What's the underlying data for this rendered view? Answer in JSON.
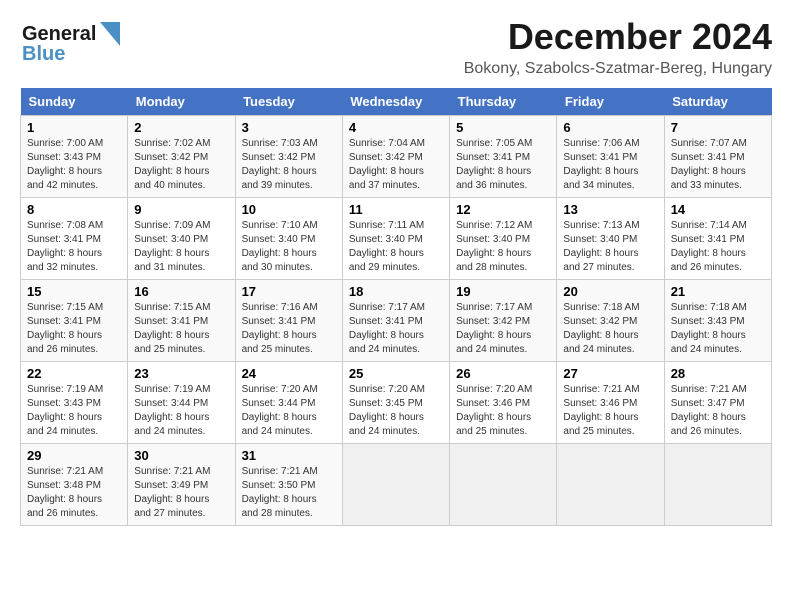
{
  "header": {
    "logo_line1": "General",
    "logo_line2": "Blue",
    "month": "December 2024",
    "location": "Bokony, Szabolcs-Szatmar-Bereg, Hungary"
  },
  "weekdays": [
    "Sunday",
    "Monday",
    "Tuesday",
    "Wednesday",
    "Thursday",
    "Friday",
    "Saturday"
  ],
  "weeks": [
    [
      {
        "day": "1",
        "sunrise": "Sunrise: 7:00 AM",
        "sunset": "Sunset: 3:43 PM",
        "daylight": "Daylight: 8 hours and 42 minutes."
      },
      {
        "day": "2",
        "sunrise": "Sunrise: 7:02 AM",
        "sunset": "Sunset: 3:42 PM",
        "daylight": "Daylight: 8 hours and 40 minutes."
      },
      {
        "day": "3",
        "sunrise": "Sunrise: 7:03 AM",
        "sunset": "Sunset: 3:42 PM",
        "daylight": "Daylight: 8 hours and 39 minutes."
      },
      {
        "day": "4",
        "sunrise": "Sunrise: 7:04 AM",
        "sunset": "Sunset: 3:42 PM",
        "daylight": "Daylight: 8 hours and 37 minutes."
      },
      {
        "day": "5",
        "sunrise": "Sunrise: 7:05 AM",
        "sunset": "Sunset: 3:41 PM",
        "daylight": "Daylight: 8 hours and 36 minutes."
      },
      {
        "day": "6",
        "sunrise": "Sunrise: 7:06 AM",
        "sunset": "Sunset: 3:41 PM",
        "daylight": "Daylight: 8 hours and 34 minutes."
      },
      {
        "day": "7",
        "sunrise": "Sunrise: 7:07 AM",
        "sunset": "Sunset: 3:41 PM",
        "daylight": "Daylight: 8 hours and 33 minutes."
      }
    ],
    [
      {
        "day": "8",
        "sunrise": "Sunrise: 7:08 AM",
        "sunset": "Sunset: 3:41 PM",
        "daylight": "Daylight: 8 hours and 32 minutes."
      },
      {
        "day": "9",
        "sunrise": "Sunrise: 7:09 AM",
        "sunset": "Sunset: 3:40 PM",
        "daylight": "Daylight: 8 hours and 31 minutes."
      },
      {
        "day": "10",
        "sunrise": "Sunrise: 7:10 AM",
        "sunset": "Sunset: 3:40 PM",
        "daylight": "Daylight: 8 hours and 30 minutes."
      },
      {
        "day": "11",
        "sunrise": "Sunrise: 7:11 AM",
        "sunset": "Sunset: 3:40 PM",
        "daylight": "Daylight: 8 hours and 29 minutes."
      },
      {
        "day": "12",
        "sunrise": "Sunrise: 7:12 AM",
        "sunset": "Sunset: 3:40 PM",
        "daylight": "Daylight: 8 hours and 28 minutes."
      },
      {
        "day": "13",
        "sunrise": "Sunrise: 7:13 AM",
        "sunset": "Sunset: 3:40 PM",
        "daylight": "Daylight: 8 hours and 27 minutes."
      },
      {
        "day": "14",
        "sunrise": "Sunrise: 7:14 AM",
        "sunset": "Sunset: 3:41 PM",
        "daylight": "Daylight: 8 hours and 26 minutes."
      }
    ],
    [
      {
        "day": "15",
        "sunrise": "Sunrise: 7:15 AM",
        "sunset": "Sunset: 3:41 PM",
        "daylight": "Daylight: 8 hours and 26 minutes."
      },
      {
        "day": "16",
        "sunrise": "Sunrise: 7:15 AM",
        "sunset": "Sunset: 3:41 PM",
        "daylight": "Daylight: 8 hours and 25 minutes."
      },
      {
        "day": "17",
        "sunrise": "Sunrise: 7:16 AM",
        "sunset": "Sunset: 3:41 PM",
        "daylight": "Daylight: 8 hours and 25 minutes."
      },
      {
        "day": "18",
        "sunrise": "Sunrise: 7:17 AM",
        "sunset": "Sunset: 3:41 PM",
        "daylight": "Daylight: 8 hours and 24 minutes."
      },
      {
        "day": "19",
        "sunrise": "Sunrise: 7:17 AM",
        "sunset": "Sunset: 3:42 PM",
        "daylight": "Daylight: 8 hours and 24 minutes."
      },
      {
        "day": "20",
        "sunrise": "Sunrise: 7:18 AM",
        "sunset": "Sunset: 3:42 PM",
        "daylight": "Daylight: 8 hours and 24 minutes."
      },
      {
        "day": "21",
        "sunrise": "Sunrise: 7:18 AM",
        "sunset": "Sunset: 3:43 PM",
        "daylight": "Daylight: 8 hours and 24 minutes."
      }
    ],
    [
      {
        "day": "22",
        "sunrise": "Sunrise: 7:19 AM",
        "sunset": "Sunset: 3:43 PM",
        "daylight": "Daylight: 8 hours and 24 minutes."
      },
      {
        "day": "23",
        "sunrise": "Sunrise: 7:19 AM",
        "sunset": "Sunset: 3:44 PM",
        "daylight": "Daylight: 8 hours and 24 minutes."
      },
      {
        "day": "24",
        "sunrise": "Sunrise: 7:20 AM",
        "sunset": "Sunset: 3:44 PM",
        "daylight": "Daylight: 8 hours and 24 minutes."
      },
      {
        "day": "25",
        "sunrise": "Sunrise: 7:20 AM",
        "sunset": "Sunset: 3:45 PM",
        "daylight": "Daylight: 8 hours and 24 minutes."
      },
      {
        "day": "26",
        "sunrise": "Sunrise: 7:20 AM",
        "sunset": "Sunset: 3:46 PM",
        "daylight": "Daylight: 8 hours and 25 minutes."
      },
      {
        "day": "27",
        "sunrise": "Sunrise: 7:21 AM",
        "sunset": "Sunset: 3:46 PM",
        "daylight": "Daylight: 8 hours and 25 minutes."
      },
      {
        "day": "28",
        "sunrise": "Sunrise: 7:21 AM",
        "sunset": "Sunset: 3:47 PM",
        "daylight": "Daylight: 8 hours and 26 minutes."
      }
    ],
    [
      {
        "day": "29",
        "sunrise": "Sunrise: 7:21 AM",
        "sunset": "Sunset: 3:48 PM",
        "daylight": "Daylight: 8 hours and 26 minutes."
      },
      {
        "day": "30",
        "sunrise": "Sunrise: 7:21 AM",
        "sunset": "Sunset: 3:49 PM",
        "daylight": "Daylight: 8 hours and 27 minutes."
      },
      {
        "day": "31",
        "sunrise": "Sunrise: 7:21 AM",
        "sunset": "Sunset: 3:50 PM",
        "daylight": "Daylight: 8 hours and 28 minutes."
      },
      null,
      null,
      null,
      null
    ]
  ]
}
